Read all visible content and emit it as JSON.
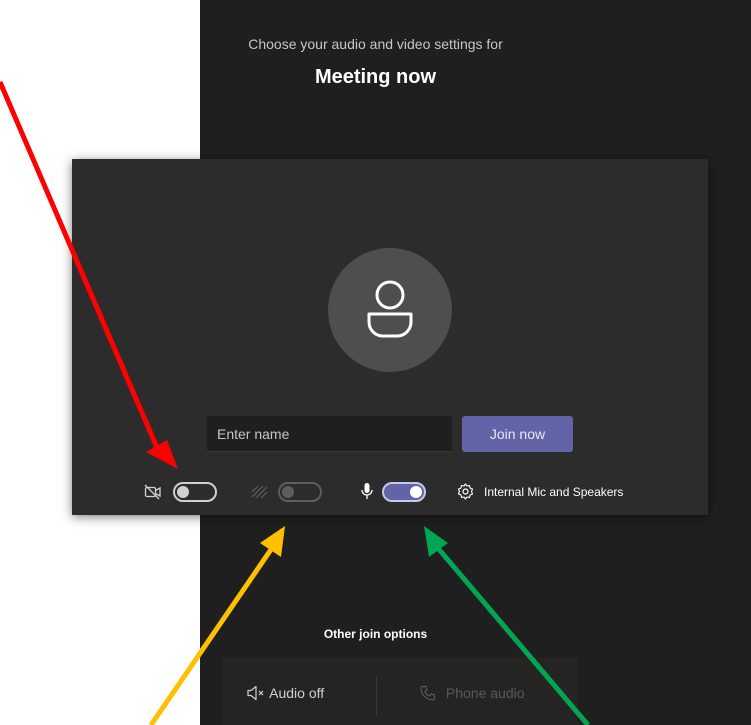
{
  "header": {
    "subtitle": "Choose your audio and video settings for",
    "title": "Meeting now"
  },
  "preview": {
    "avatar_icon": "person-icon",
    "name_placeholder": "Enter name",
    "join_label": "Join now"
  },
  "controls": {
    "camera": {
      "icon": "camera-off-icon",
      "state": "off"
    },
    "background_blur": {
      "icon": "background-blur-icon",
      "state": "off-disabled"
    },
    "microphone": {
      "icon": "microphone-icon",
      "state": "on"
    },
    "device_settings": {
      "icon": "gear-icon",
      "label": "Internal Mic and Speakers"
    }
  },
  "other_options": {
    "title": "Other join options",
    "audio_off_label": "Audio off",
    "phone_audio_label": "Phone audio"
  },
  "annotations": {
    "red_arrow_color": "#ff0000",
    "yellow_arrow_color": "#ffc000",
    "green_arrow_color": "#00a651"
  },
  "colors": {
    "background": "#201f1f",
    "panel": "#2d2c2c",
    "accent": "#6264a7"
  }
}
